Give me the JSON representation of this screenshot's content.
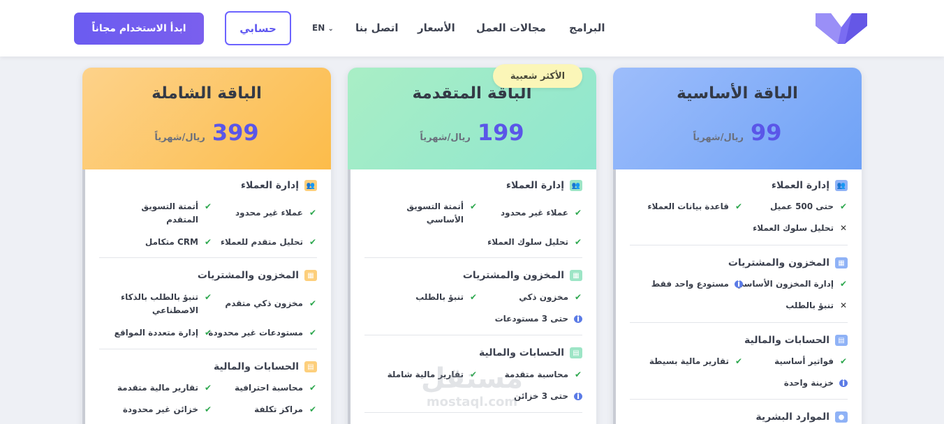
{
  "nav": {
    "programs": "البرامج",
    "fields": "مجالات العمل",
    "prices": "الأسعار",
    "contact": "اتصل بنا",
    "lang": "EN",
    "account_button": "حسابي",
    "start_button": "ابدأ الاستخدام مجاناً"
  },
  "badge": "الأكثر شعبية",
  "colors": {
    "accent": "#6c63ff",
    "check": "#2ea84f",
    "basic": "#7aa8f7",
    "advanced": "#9be9cc",
    "full": "#fcc559"
  },
  "plans": {
    "basic": {
      "title": "الباقة الأساسية",
      "price": "99",
      "period": "ريال/شهرياً",
      "sections": [
        {
          "title": "إدارة العملاء",
          "icon": "users-icon",
          "features": [
            {
              "text": "حتى 500 عميل",
              "mark": "check"
            },
            {
              "text": "قاعدة بيانات العملاء",
              "mark": "check"
            },
            {
              "text": "تحليل سلوك العملاء",
              "mark": "x"
            }
          ]
        },
        {
          "title": "المخزون والمشتريات",
          "icon": "boxes-icon",
          "features": [
            {
              "text": "إدارة المخزون الأساسي",
              "mark": "check"
            },
            {
              "text": "مستودع واحد فقط",
              "mark": "info"
            },
            {
              "text": "تنبؤ بالطلب",
              "mark": "x"
            }
          ]
        },
        {
          "title": "الحسابات والمالية",
          "icon": "calculator-icon",
          "features": [
            {
              "text": "فواتير أساسية",
              "mark": "check"
            },
            {
              "text": "تقارير مالية بسيطة",
              "mark": "check"
            },
            {
              "text": "خزينة واحدة",
              "mark": "info"
            }
          ]
        },
        {
          "title": "الموارد البشرية",
          "icon": "user-icon",
          "features": []
        }
      ]
    },
    "advanced": {
      "title": "الباقة المتقدمة",
      "price": "199",
      "period": "ريال/شهرياً",
      "sections": [
        {
          "title": "إدارة العملاء",
          "icon": "users-icon",
          "features": [
            {
              "text": "عملاء غير محدود",
              "mark": "check"
            },
            {
              "text": "أتمتة التسويق\nالأساسي",
              "mark": "check"
            },
            {
              "text": "تحليل سلوك العملاء",
              "mark": "check"
            }
          ]
        },
        {
          "title": "المخزون والمشتريات",
          "icon": "boxes-icon",
          "features": [
            {
              "text": "مخزون ذكي",
              "mark": "check"
            },
            {
              "text": "تنبؤ بالطلب",
              "mark": "check"
            },
            {
              "text": "حتى 3 مستودعات",
              "mark": "info"
            }
          ]
        },
        {
          "title": "الحسابات والمالية",
          "icon": "calculator-icon",
          "features": [
            {
              "text": "محاسبة متقدمة",
              "mark": "check"
            },
            {
              "text": "تقارير مالية شاملة",
              "mark": "check"
            },
            {
              "text": "حتى 3 خزائن",
              "mark": "info"
            }
          ]
        }
      ]
    },
    "full": {
      "title": "الباقة الشاملة",
      "price": "399",
      "period": "ريال/شهرياً",
      "sections": [
        {
          "title": "إدارة العملاء",
          "icon": "users-icon",
          "features": [
            {
              "text": "عملاء غير محدود",
              "mark": "check"
            },
            {
              "text": "أتمتة التسويق\nالمتقدم",
              "mark": "check"
            },
            {
              "text": "تحليل متقدم للعملاء",
              "mark": "check"
            },
            {
              "text": "CRM متكامل",
              "mark": "check"
            }
          ]
        },
        {
          "title": "المخزون والمشتريات",
          "icon": "boxes-icon",
          "features": [
            {
              "text": "مخزون ذكي متقدم",
              "mark": "check"
            },
            {
              "text": "تنبؤ بالطلب بالذكاء\nالاصطناعي",
              "mark": "check"
            },
            {
              "text": "مستودعات غير محدودة",
              "mark": "check"
            },
            {
              "text": "إدارة متعددة المواقع",
              "mark": "check"
            }
          ]
        },
        {
          "title": "الحسابات والمالية",
          "icon": "calculator-icon",
          "features": [
            {
              "text": "محاسبة احترافية",
              "mark": "check"
            },
            {
              "text": "تقارير مالية متقدمة",
              "mark": "check"
            },
            {
              "text": "مراكز تكلفة",
              "mark": "check"
            },
            {
              "text": "خزائن غير محدودة",
              "mark": "check"
            }
          ]
        }
      ]
    }
  },
  "watermark": {
    "arabic": "مستقل",
    "latin": "mostaql.com"
  }
}
